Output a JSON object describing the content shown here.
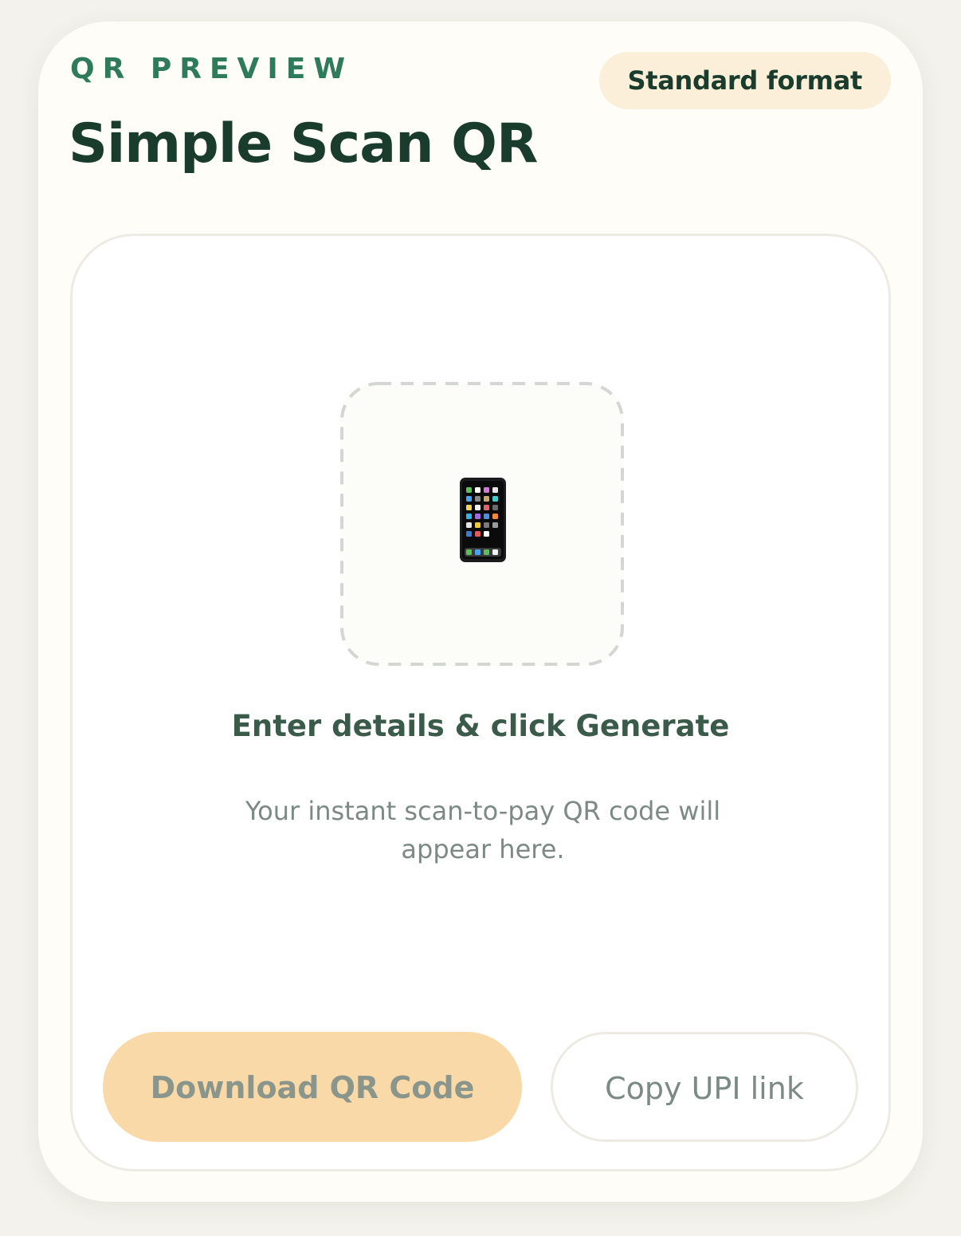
{
  "panel": {
    "eyebrow": "QR PREVIEW",
    "title": "Simple Scan QR",
    "badge": "Standard format"
  },
  "preview": {
    "icon": "mobile-phone-icon",
    "heading": "Enter details & click Generate",
    "description": "Your instant scan-to-pay QR code will appear here."
  },
  "actions": {
    "download_label": "Download QR Code",
    "copy_label": "Copy UPI link"
  },
  "colors": {
    "accent_green": "#2e7a59",
    "title_dark": "#1a3c2d",
    "badge_bg": "#fcefd9",
    "download_bg": "#f8d9a7"
  }
}
